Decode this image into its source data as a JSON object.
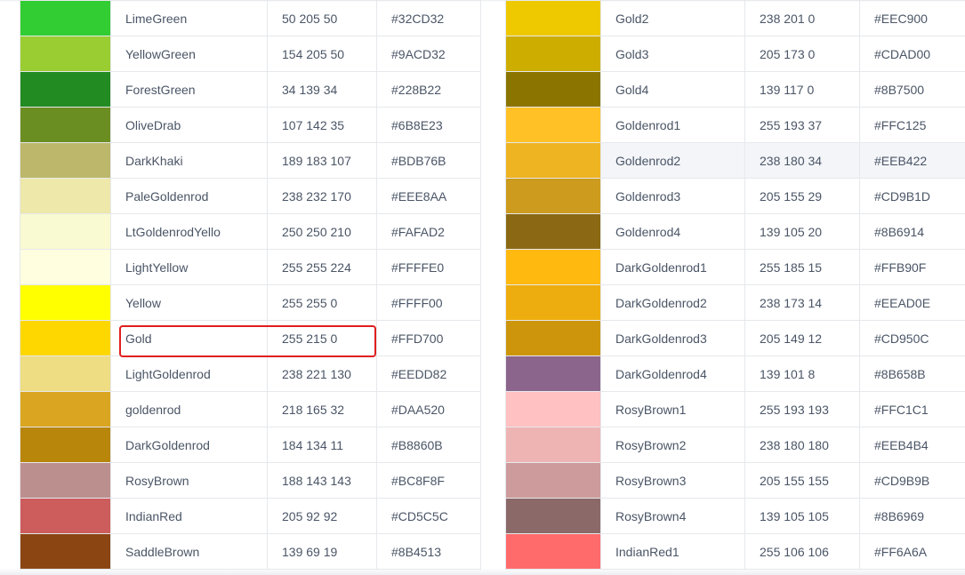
{
  "left_table": [
    {
      "name": "LimeGreen",
      "rgb": "50 205 50",
      "hex": "#32CD32"
    },
    {
      "name": "YellowGreen",
      "rgb": "154 205 50",
      "hex": "#9ACD32"
    },
    {
      "name": "ForestGreen",
      "rgb": "34 139 34",
      "hex": "#228B22"
    },
    {
      "name": "OliveDrab",
      "rgb": "107 142 35",
      "hex": "#6B8E23"
    },
    {
      "name": "DarkKhaki",
      "rgb": "189 183 107",
      "hex": "#BDB76B"
    },
    {
      "name": "PaleGoldenrod",
      "rgb": "238 232 170",
      "hex": "#EEE8AA"
    },
    {
      "name": "LtGoldenrodYello",
      "rgb": "250 250 210",
      "hex": "#FAFAD2"
    },
    {
      "name": "LightYellow",
      "rgb": "255 255 224",
      "hex": "#FFFFE0"
    },
    {
      "name": "Yellow",
      "rgb": "255 255 0",
      "hex": "#FFFF00"
    },
    {
      "name": "Gold",
      "rgb": "255 215 0",
      "hex": "#FFD700"
    },
    {
      "name": "LightGoldenrod",
      "rgb": "238 221 130",
      "hex": "#EEDD82"
    },
    {
      "name": "goldenrod",
      "rgb": "218 165 32",
      "hex": "#DAA520"
    },
    {
      "name": "DarkGoldenrod",
      "rgb": "184 134 11",
      "hex": "#B8860B"
    },
    {
      "name": "RosyBrown",
      "rgb": "188 143 143",
      "hex": "#BC8F8F"
    },
    {
      "name": "IndianRed",
      "rgb": "205 92 92",
      "hex": "#CD5C5C"
    },
    {
      "name": "SaddleBrown",
      "rgb": "139 69 19",
      "hex": "#8B4513"
    }
  ],
  "right_table": [
    {
      "name": "Gold2",
      "rgb": "238 201 0",
      "hex": "#EEC900"
    },
    {
      "name": "Gold3",
      "rgb": "205 173 0",
      "hex": "#CDAD00"
    },
    {
      "name": "Gold4",
      "rgb": "139 117 0",
      "hex": "#8B7500"
    },
    {
      "name": "Goldenrod1",
      "rgb": "255 193 37",
      "hex": "#FFC125"
    },
    {
      "name": "Goldenrod2",
      "rgb": "238 180 34",
      "hex": "#EEB422"
    },
    {
      "name": "Goldenrod3",
      "rgb": "205 155 29",
      "hex": "#CD9B1D"
    },
    {
      "name": "Goldenrod4",
      "rgb": "139 105 20",
      "hex": "#8B6914"
    },
    {
      "name": "DarkGoldenrod1",
      "rgb": "255 185 15",
      "hex": "#FFB90F"
    },
    {
      "name": "DarkGoldenrod2",
      "rgb": "238 173 14",
      "hex": "#EEAD0E"
    },
    {
      "name": "DarkGoldenrod3",
      "rgb": "205 149 12",
      "hex": "#CD950C"
    },
    {
      "name": "DarkGoldenrod4",
      "rgb": "139 101 8",
      "hex": "#8B658B"
    },
    {
      "name": "RosyBrown1",
      "rgb": "255 193 193",
      "hex": "#FFC1C1"
    },
    {
      "name": "RosyBrown2",
      "rgb": "238 180 180",
      "hex": "#EEB4B4"
    },
    {
      "name": "RosyBrown3",
      "rgb": "205 155 155",
      "hex": "#CD9B9B"
    },
    {
      "name": "RosyBrown4",
      "rgb": "139 105 105",
      "hex": "#8B6969"
    },
    {
      "name": "IndianRed1",
      "rgb": "255 106 106",
      "hex": "#FF6A6A"
    }
  ],
  "highlighted_row": "Gold",
  "hovered_row": "Goldenrod2",
  "highlight_color": "#E01E1E"
}
